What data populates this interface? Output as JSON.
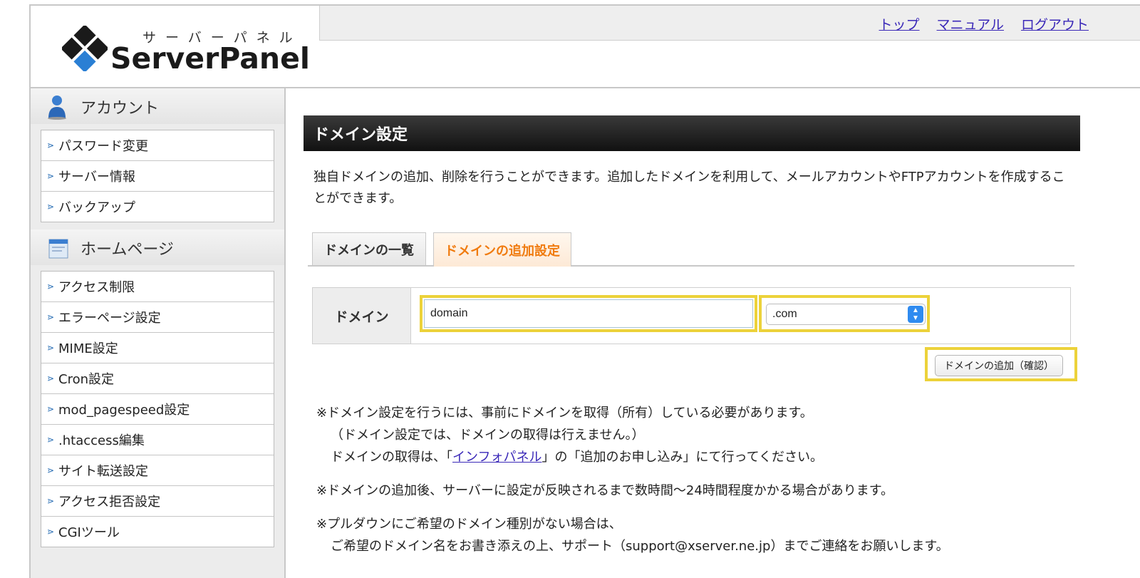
{
  "header": {
    "logo_kana": "サーバーパネル",
    "logo_text": "ServerPanel",
    "nav": [
      "トップ",
      "マニュアル",
      "ログアウト"
    ]
  },
  "sidebar": {
    "sections": [
      {
        "title": "アカウント",
        "icon": "user-icon",
        "items": [
          "パスワード変更",
          "サーバー情報",
          "バックアップ"
        ]
      },
      {
        "title": "ホームページ",
        "icon": "homepage-icon",
        "items": [
          "アクセス制限",
          "エラーページ設定",
          "MIME設定",
          "Cron設定",
          "mod_pagespeed設定",
          ".htaccess編集",
          "サイト転送設定",
          "アクセス拒否設定",
          "CGIツール"
        ]
      }
    ]
  },
  "main": {
    "title": "ドメイン設定",
    "description": "独自ドメインの追加、削除を行うことができます。追加したドメインを利用して、メールアカウントやFTPアカウントを作成することができます。",
    "tabs": [
      {
        "label": "ドメインの一覧",
        "active": false
      },
      {
        "label": "ドメインの追加設定",
        "active": true
      }
    ],
    "form": {
      "label": "ドメイン",
      "domain_value": "domain",
      "tld_selected": ".com",
      "submit_label": "ドメインの追加（確認）"
    },
    "notes": {
      "n1_line1": "※ドメイン設定を行うには、事前にドメインを取得（所有）している必要があります。",
      "n1_line2": "（ドメイン設定では、ドメインの取得は行えません。）",
      "n1_line3_pre": "ドメインの取得は、「",
      "n1_link": "インフォパネル",
      "n1_line3_post": "」の「追加のお申し込み」にて行ってください。",
      "n2": "※ドメインの追加後、サーバーに設定が反映されるまで数時間〜24時間程度かかる場合があります。",
      "n3_line1": "※プルダウンにご希望のドメイン種別がない場合は、",
      "n3_line2": "ご希望のドメイン名をお書き添えの上、サポート（support@xserver.ne.jp）までご連絡をお願いします。"
    }
  },
  "colors": {
    "highlight": "#ecd23a",
    "active_tab_text": "#f07b0f",
    "link": "#3a28b8"
  }
}
